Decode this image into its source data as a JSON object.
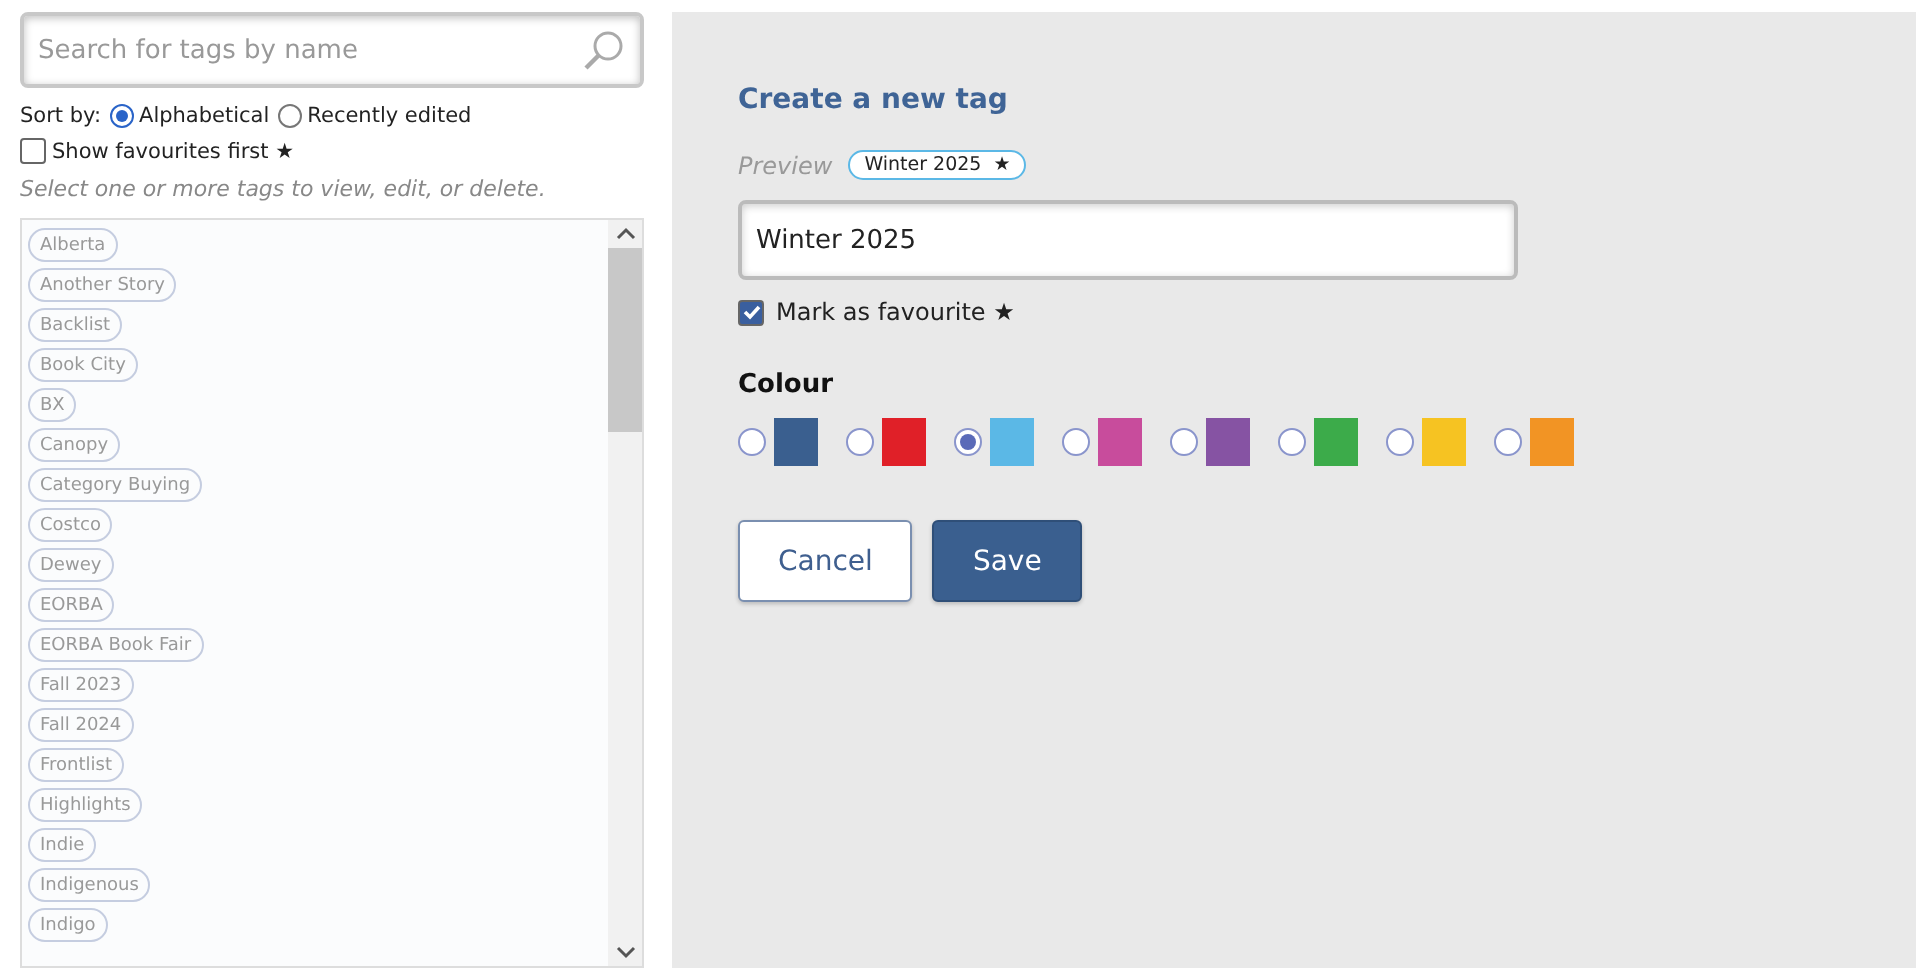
{
  "search": {
    "placeholder": "Search for tags by name"
  },
  "sort": {
    "label": "Sort by:",
    "options": [
      {
        "label": "Alphabetical",
        "selected": true
      },
      {
        "label": "Recently edited",
        "selected": false
      }
    ]
  },
  "favourites_first": {
    "label": "Show favourites first ★",
    "checked": false
  },
  "hint": "Select one or more tags to view, edit, or delete.",
  "tags": [
    "Alberta",
    "Another Story",
    "Backlist",
    "Book City",
    "BX",
    "Canopy",
    "Category Buying",
    "Costco",
    "Dewey",
    "EORBA",
    "EORBA Book Fair",
    "Fall 2023",
    "Fall 2024",
    "Frontlist",
    "Highlights",
    "Indie",
    "Indigenous",
    "Indigo"
  ],
  "form": {
    "title": "Create a new tag",
    "preview_label": "Preview",
    "preview_tag": "Winter 2025",
    "preview_star": "★",
    "name_value": "Winter 2025",
    "favourite": {
      "label": "Mark as favourite ★",
      "checked": true
    },
    "colour_label": "Colour",
    "colours": [
      {
        "color": "#3a5f8f",
        "selected": false
      },
      {
        "color": "#e02028",
        "selected": false
      },
      {
        "color": "#5bb8e6",
        "selected": true
      },
      {
        "color": "#c84c9c",
        "selected": false
      },
      {
        "color": "#8653a3",
        "selected": false
      },
      {
        "color": "#3cab4a",
        "selected": false
      },
      {
        "color": "#f6c322",
        "selected": false
      },
      {
        "color": "#f29424",
        "selected": false
      }
    ],
    "buttons": [
      {
        "label": "Cancel",
        "kind": "secondary"
      },
      {
        "label": "Save",
        "kind": "primary"
      }
    ]
  }
}
